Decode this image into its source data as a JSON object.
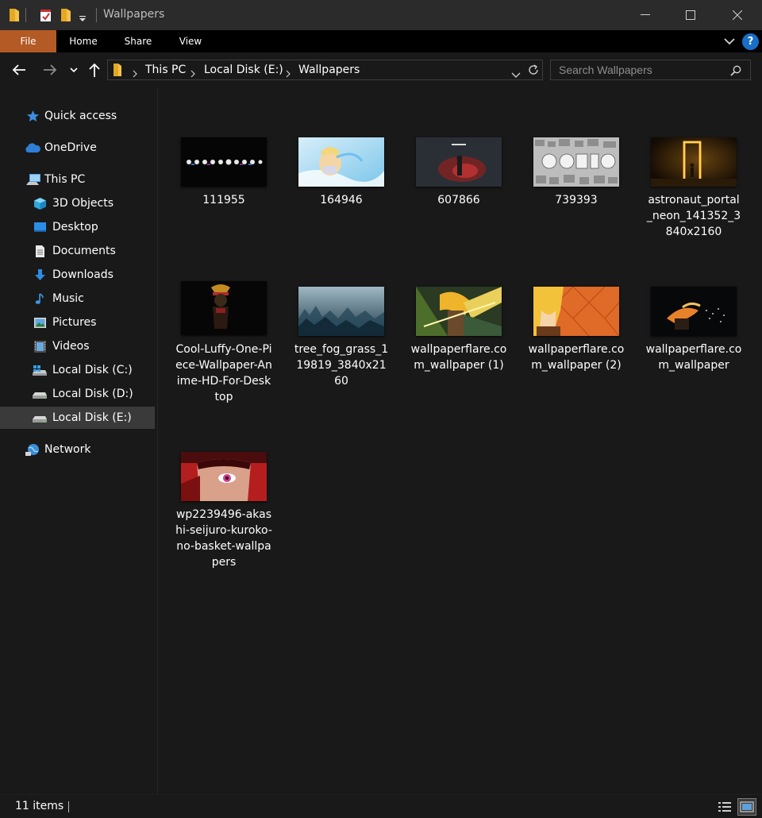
{
  "window": {
    "title": "Wallpapers",
    "minimize_glyph": "—",
    "maximize_glyph": "☐",
    "close_glyph": "✕"
  },
  "ribbon": {
    "tabs": [
      "File",
      "Home",
      "Share",
      "View"
    ],
    "help_glyph": "?",
    "file_color": "#b35a25"
  },
  "address": {
    "crumbs": [
      "This PC",
      "Local Disk (E:)",
      "Wallpapers"
    ]
  },
  "search": {
    "placeholder": "Search Wallpapers"
  },
  "sidebar": {
    "items": [
      {
        "label": "Quick access",
        "icon": "star-icon"
      },
      {
        "label": "OneDrive",
        "icon": "cloud-icon"
      },
      {
        "label": "This PC",
        "icon": "computer-icon"
      },
      {
        "label": "3D Objects",
        "icon": "cube-icon"
      },
      {
        "label": "Desktop",
        "icon": "desktop-icon"
      },
      {
        "label": "Documents",
        "icon": "document-icon"
      },
      {
        "label": "Downloads",
        "icon": "download-icon"
      },
      {
        "label": "Music",
        "icon": "music-icon"
      },
      {
        "label": "Pictures",
        "icon": "pictures-icon"
      },
      {
        "label": "Videos",
        "icon": "video-icon"
      },
      {
        "label": "Local Disk (C:)",
        "icon": "windows-drive-icon"
      },
      {
        "label": "Local Disk (D:)",
        "icon": "drive-icon"
      },
      {
        "label": "Local Disk (E:)",
        "icon": "drive-icon"
      },
      {
        "label": "Network",
        "icon": "network-icon"
      }
    ],
    "selected": "Local Disk (E:)"
  },
  "files": [
    {
      "name": "111955",
      "thumb": "black-banner"
    },
    {
      "name": "164946",
      "thumb": "anime-ice"
    },
    {
      "name": "607866",
      "thumb": "dark-red"
    },
    {
      "name": "739393",
      "thumb": "collage"
    },
    {
      "name": "astronaut_portal_neon_141352_3840x2160",
      "thumb": "neon-portal"
    },
    {
      "name": "Cool-Luffy-One-Piece-Wallpaper-Anime-HD-For-Desktop",
      "thumb": "dark-luffy"
    },
    {
      "name": "tree_fog_grass_119819_3840x2160",
      "thumb": "foggy-forest"
    },
    {
      "name": "wallpaperflare.com_wallpaper (1)",
      "thumb": "anime-green"
    },
    {
      "name": "wallpaperflare.com_wallpaper (2)",
      "thumb": "anime-orange"
    },
    {
      "name": "wallpaperflare.com_wallpaper",
      "thumb": "anime-dark-fire"
    },
    {
      "name": "wp2239496-akashi-seijuro-kuroko-no-basket-wallpapers",
      "thumb": "red-eye"
    }
  ],
  "status": {
    "item_count": "11 items"
  }
}
